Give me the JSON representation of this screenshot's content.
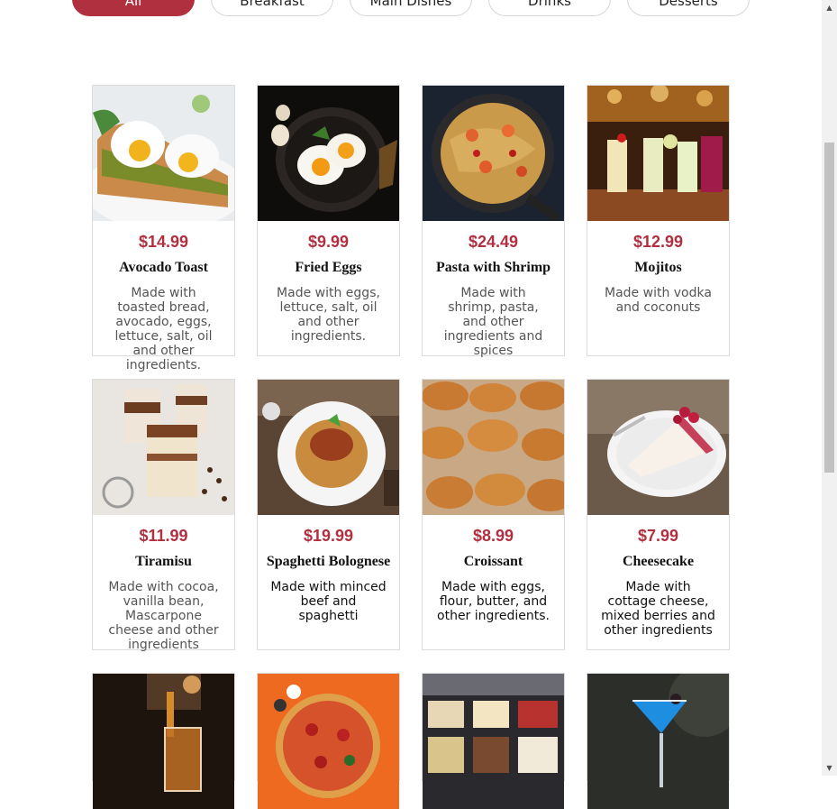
{
  "filters": [
    {
      "label": "All",
      "active": true
    },
    {
      "label": "Breakfast",
      "active": false
    },
    {
      "label": "Main Dishes",
      "active": false
    },
    {
      "label": "Drinks",
      "active": false
    },
    {
      "label": "Desserts",
      "active": false
    }
  ],
  "items": [
    {
      "price": "$14.99",
      "name": "Avocado Toast",
      "desc": "Made with toasted bread, avocado, eggs, lettuce, salt, oil and other ingredients.",
      "image": "avocado-toast-photo"
    },
    {
      "price": "$9.99",
      "name": "Fried Eggs",
      "desc": "Made with eggs, lettuce, salt, oil and other ingredients.",
      "image": "fried-eggs-photo"
    },
    {
      "price": "$24.49",
      "name": "Pasta with Shrimp",
      "desc": "Made with shrimp, pasta, and other ingredients and spices",
      "image": "pasta-shrimp-photo"
    },
    {
      "price": "$12.99",
      "name": "Mojitos",
      "desc": "Made with vodka and coconuts",
      "image": "mojitos-photo"
    },
    {
      "price": "$11.99",
      "name": "Tiramisu",
      "desc": "Made with cocoa, vanilla bean, Mascarpone cheese and other ingredients",
      "image": "tiramisu-photo"
    },
    {
      "price": "$19.99",
      "name": "Spaghetti Bolognese",
      "desc": "Made with minced beef and spaghetti",
      "image": "spaghetti-photo"
    },
    {
      "price": "$8.99",
      "name": "Croissant",
      "desc": "Made with eggs, flour, butter, and other ingredients.",
      "image": "croissant-photo"
    },
    {
      "price": "$7.99",
      "name": "Cheesecake",
      "desc": "Made with cottage cheese, mixed berries and other ingredients",
      "image": "cheesecake-photo"
    },
    {
      "image": "whiskey-pour-photo"
    },
    {
      "image": "pizza-photo"
    },
    {
      "image": "gelato-photo"
    },
    {
      "image": "blue-cocktail-photo"
    }
  ],
  "colors": {
    "accent": "#b0303f",
    "border": "#dcdcdc",
    "scrollbar": "#c1c1c1"
  },
  "icons": {
    "scroll_up": "triangle-up-icon",
    "scroll_down": "triangle-down-icon"
  }
}
